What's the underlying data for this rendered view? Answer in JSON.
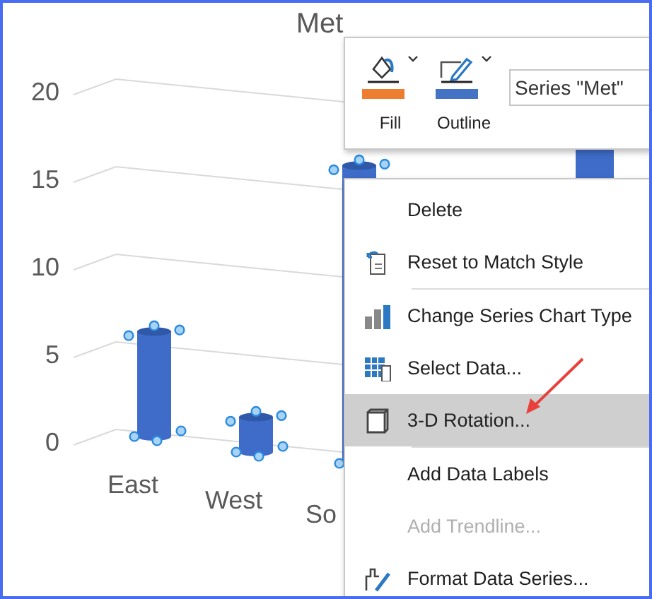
{
  "chart": {
    "title": "Met",
    "y_axis_labels": [
      "20",
      "15",
      "10",
      "5",
      "0"
    ],
    "category_labels": [
      "East",
      "West",
      "So"
    ]
  },
  "mini_toolbar": {
    "buttons": [
      {
        "label": "Fill",
        "color": "#ed7d31"
      },
      {
        "label": "Outline",
        "color": "#4472c4"
      }
    ],
    "element_picker": {
      "value": "Series \"Met\""
    }
  },
  "context_menu": {
    "items": [
      {
        "label": "Delete",
        "selected": false,
        "disabled": false,
        "divider_after": false
      },
      {
        "label": "Reset to Match Style",
        "selected": false,
        "disabled": false,
        "divider_after": true
      },
      {
        "label": "Change Series Chart Type",
        "selected": false,
        "disabled": false,
        "divider_after": false
      },
      {
        "label": "Select Data...",
        "selected": false,
        "disabled": false,
        "divider_after": false
      },
      {
        "label": "3-D Rotation...",
        "selected": true,
        "disabled": false,
        "divider_after": true
      },
      {
        "label": "Add Data Labels",
        "selected": false,
        "disabled": false,
        "divider_after": false
      },
      {
        "label": "Add Trendline...",
        "selected": false,
        "disabled": true,
        "divider_after": false
      },
      {
        "label": "Format Data Series...",
        "selected": false,
        "disabled": false,
        "divider_after": false
      }
    ]
  }
}
